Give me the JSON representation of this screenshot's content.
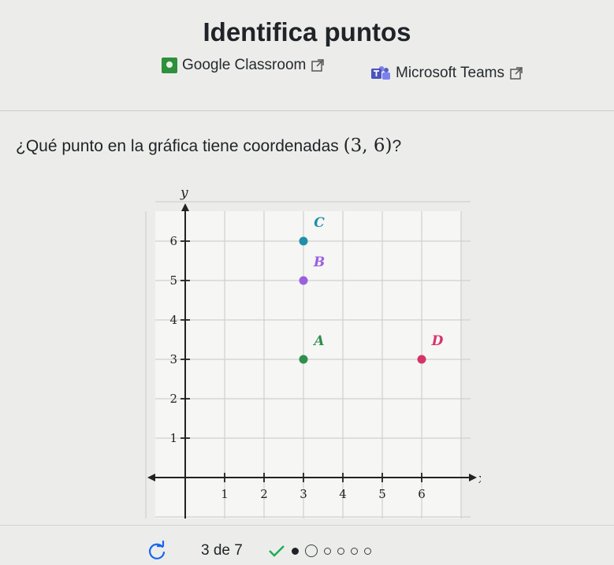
{
  "header": {
    "title": "Identifica puntos",
    "share": [
      {
        "label": "Google Classroom",
        "icon": "google-classroom-icon"
      },
      {
        "label": "Microsoft Teams",
        "icon": "microsoft-teams-icon"
      }
    ]
  },
  "question": {
    "prefix": "¿Qué punto en la gráfica tiene coordenadas ",
    "coordinates": "(3, 6)",
    "suffix": "?"
  },
  "chart_data": {
    "type": "scatter",
    "xlabel": "x",
    "ylabel": "y",
    "xlim": [
      -1,
      7
    ],
    "ylim": [
      -1,
      7
    ],
    "x_ticks": [
      1,
      2,
      3,
      4,
      5,
      6
    ],
    "y_ticks": [
      1,
      2,
      3,
      4,
      5,
      6
    ],
    "grid": true,
    "points": [
      {
        "label": "A",
        "x": 3,
        "y": 3,
        "color": "#2f8f4e"
      },
      {
        "label": "B",
        "x": 3,
        "y": 5,
        "color": "#9b5fe0"
      },
      {
        "label": "C",
        "x": 3,
        "y": 6,
        "color": "#1e90a8"
      },
      {
        "label": "D",
        "x": 6,
        "y": 3,
        "color": "#d6336c"
      }
    ]
  },
  "footer": {
    "progress": "3 de 7",
    "current_index": 3,
    "total": 7,
    "completed": 2
  }
}
